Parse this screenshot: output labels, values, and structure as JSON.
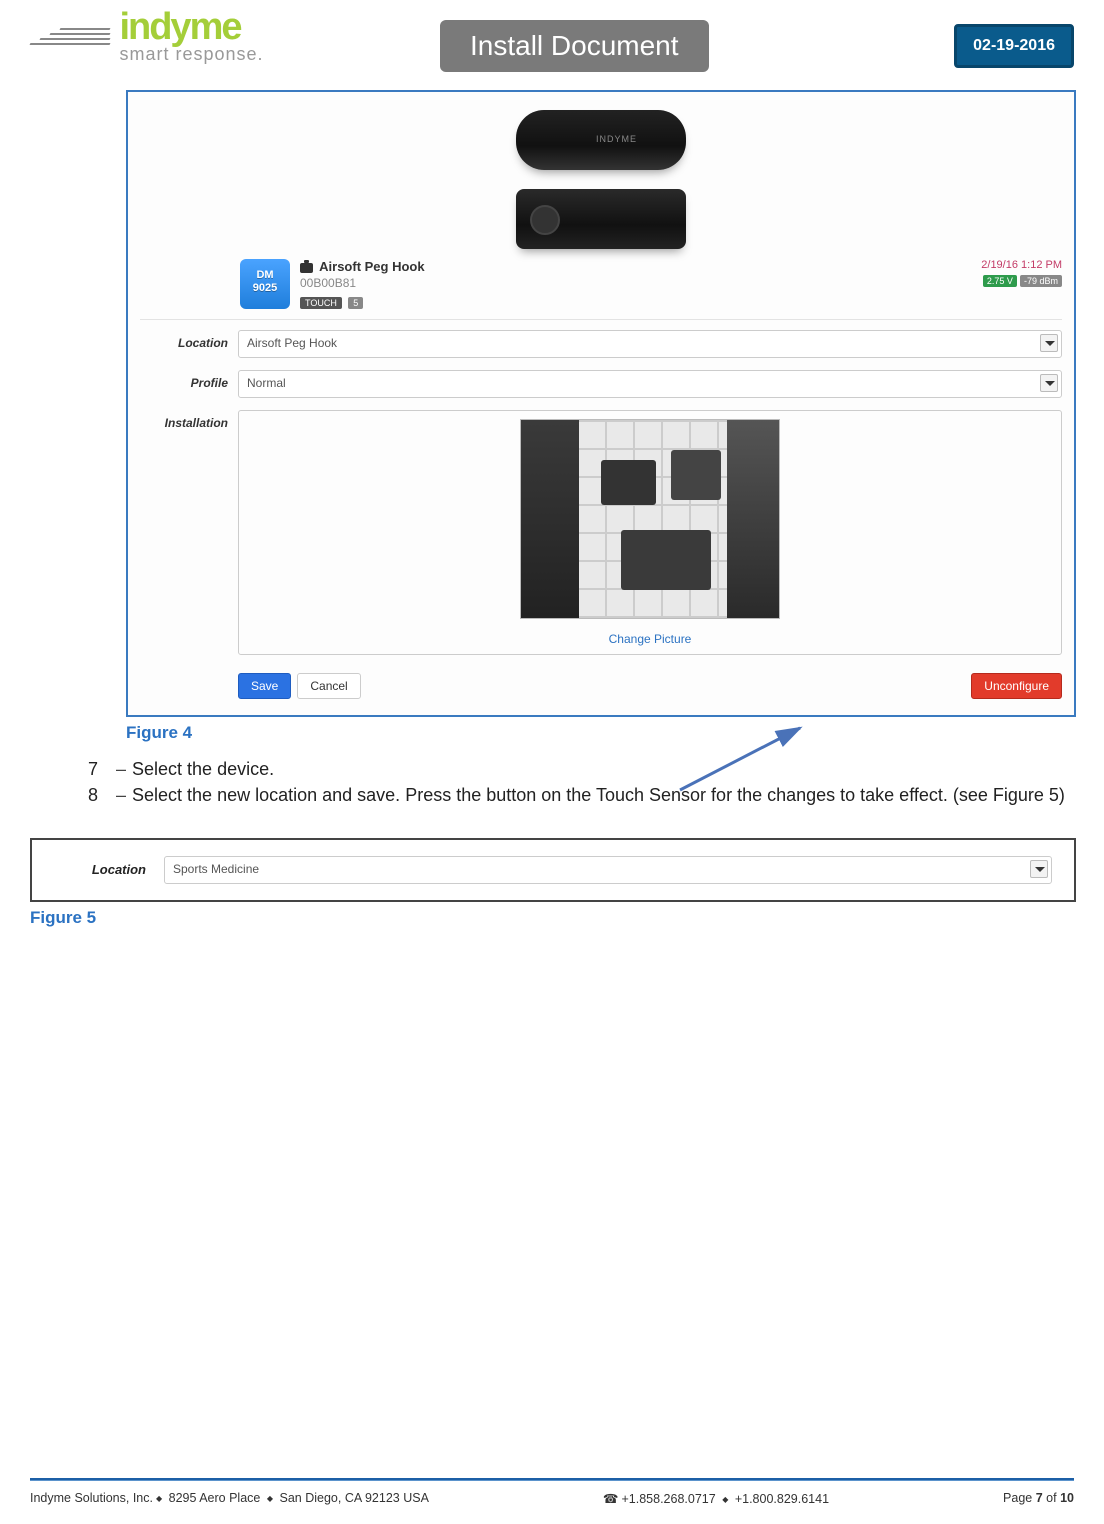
{
  "header": {
    "brand_main": "indyme",
    "brand_sub": "smart response.",
    "title": "Install Document",
    "date": "02-19-2016"
  },
  "figure4": {
    "caption": "Figure 4",
    "dm_badge_line1": "DM",
    "dm_badge_line2": "9025",
    "device_title": "Airsoft Peg Hook",
    "device_id": "00B00B81",
    "tag_touch": "TOUCH",
    "tag_num": "5",
    "timestamp": "2/19/16 1:12 PM",
    "voltage": "2.75 V",
    "signal": "-79 dBm",
    "labels": {
      "location": "Location",
      "profile": "Profile",
      "installation": "Installation"
    },
    "values": {
      "location": "Airsoft Peg Hook",
      "profile": "Normal"
    },
    "change_picture": "Change Picture",
    "buttons": {
      "save": "Save",
      "cancel": "Cancel",
      "unconfigure": "Unconfigure"
    }
  },
  "steps": {
    "s7_num": "7",
    "s7_text": "Select the device.",
    "s8_num": "8",
    "s8_text": "Select the new location and save. Press the button on the Touch Sensor for the changes to take effect. (see Figure 5)"
  },
  "figure5": {
    "caption": "Figure 5",
    "label": "Location",
    "value": "Sports Medicine"
  },
  "footer": {
    "left_company": "Indyme Solutions, Inc.",
    "left_address": "8295 Aero Place",
    "left_city": "San Diego, CA 92123 USA",
    "phone1": "+1.858.268.0717",
    "phone2": "+1.800.829.6141",
    "page_label": "Page",
    "page_cur": "7",
    "page_of": "of",
    "page_total": "10"
  }
}
